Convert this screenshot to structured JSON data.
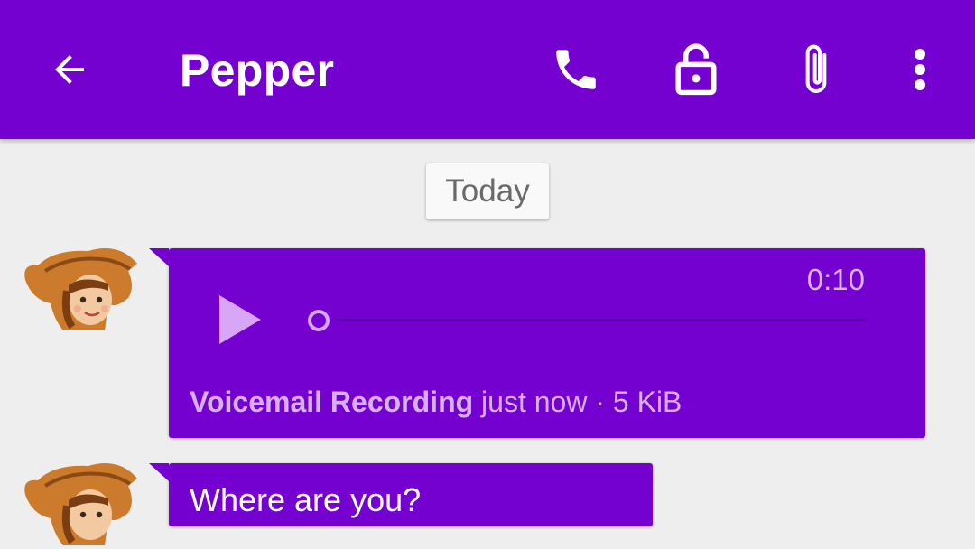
{
  "toolbar": {
    "title": "Pepper",
    "icons": [
      "arrow-back-icon",
      "phone-icon",
      "lock-open-icon",
      "paperclip-icon",
      "more-vert-icon"
    ],
    "background": "#7401d0"
  },
  "conversation": {
    "date_separator": "Today",
    "messages": [
      {
        "type": "audio",
        "duration": "0:10",
        "playback_progress": 0,
        "attachment_name": "Voicemail Recording",
        "details": "just now · 5 KiB",
        "bubble_color": "#7401d0"
      },
      {
        "type": "text",
        "text": "Where are you?",
        "bubble_color": "#7401d0"
      }
    ]
  }
}
